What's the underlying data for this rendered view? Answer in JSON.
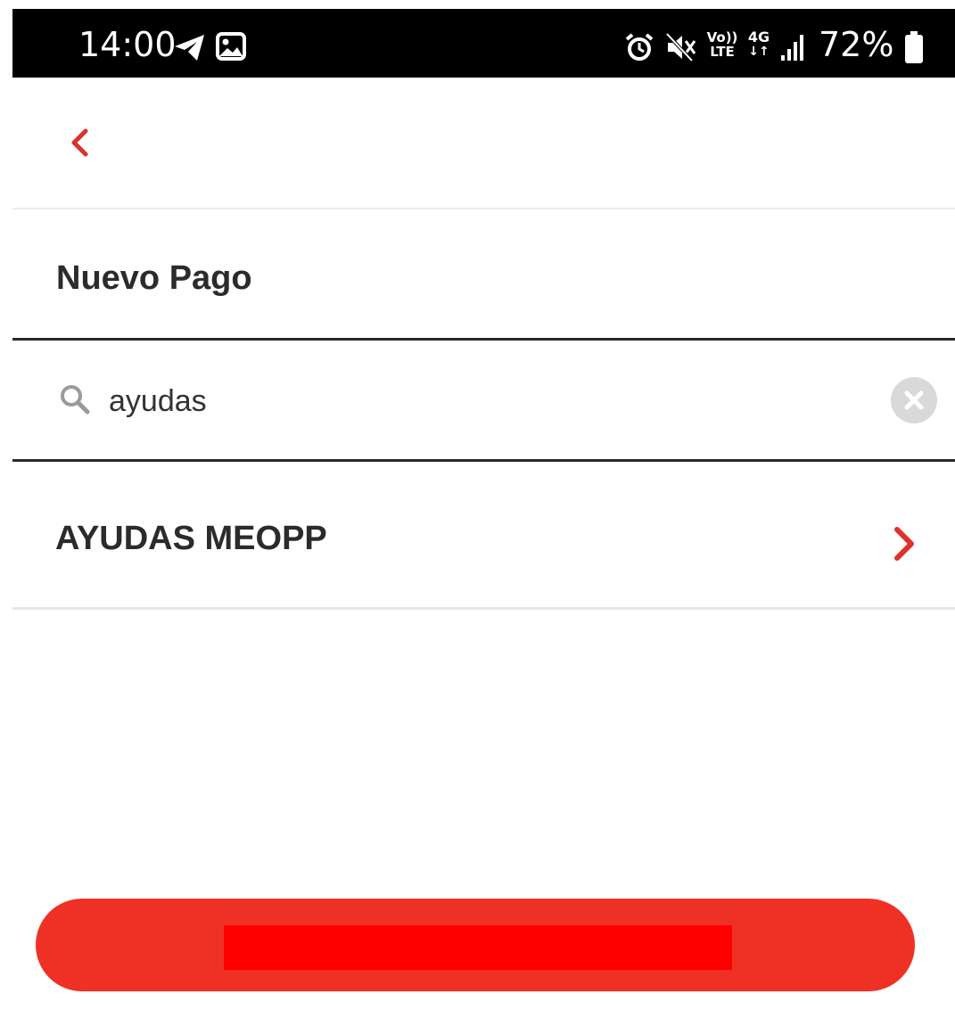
{
  "status_bar": {
    "time": "14:00",
    "battery_percent": "72%",
    "network_type": "4G",
    "volte_line1": "Vo))",
    "volte_line2": "LTE",
    "icons": [
      "telegram-icon",
      "gallery-icon",
      "alarm-icon",
      "mute-icon",
      "volte-icon",
      "network-4g-icon",
      "signal-icon",
      "battery-icon"
    ]
  },
  "header": {
    "back_icon": "chevron-left-icon"
  },
  "page": {
    "title": "Nuevo Pago"
  },
  "search": {
    "value": "ayudas",
    "icon": "search-icon",
    "clear_icon": "clear-icon"
  },
  "results": [
    {
      "label": "AYUDAS MEOPP",
      "icon": "chevron-right-icon"
    }
  ],
  "colors": {
    "accent": "#ee3124",
    "status_bar_bg": "#000000",
    "text": "#2b2b2b",
    "clear_bg": "#d9d9d9",
    "redaction": "#ff0000"
  }
}
